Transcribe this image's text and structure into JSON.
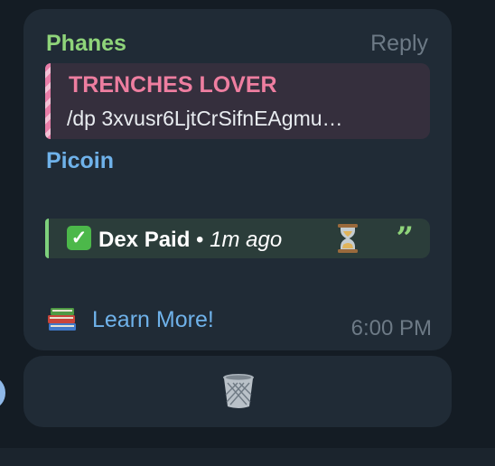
{
  "message": {
    "sender": "Phanes",
    "reply_label": "Reply",
    "quote": {
      "author": "TRENCHES LOVER",
      "text": "/dp 3xvusr6LjtCrSifnEAgmu…"
    },
    "coin_link": "Picoin",
    "status": {
      "check_icon": "check-mark-icon",
      "label": "Dex Paid",
      "separator": " • ",
      "time_ago": "1m ago",
      "hourglass_icon": "hourglass-icon",
      "quote_icon": "quote-mark-icon"
    },
    "books_icon": "books-icon",
    "learn_more": "Learn More!",
    "timestamp": "6:00 PM"
  },
  "action_bar": {
    "trash_icon": "wastebasket-icon"
  },
  "colors": {
    "background": "#141c24",
    "bubble": "#202b36",
    "sender": "#8fd47a",
    "quote_author": "#ee7ea0",
    "link": "#6fb2ea",
    "muted": "#6d7a86",
    "status_bg": "#2b3d3a"
  }
}
